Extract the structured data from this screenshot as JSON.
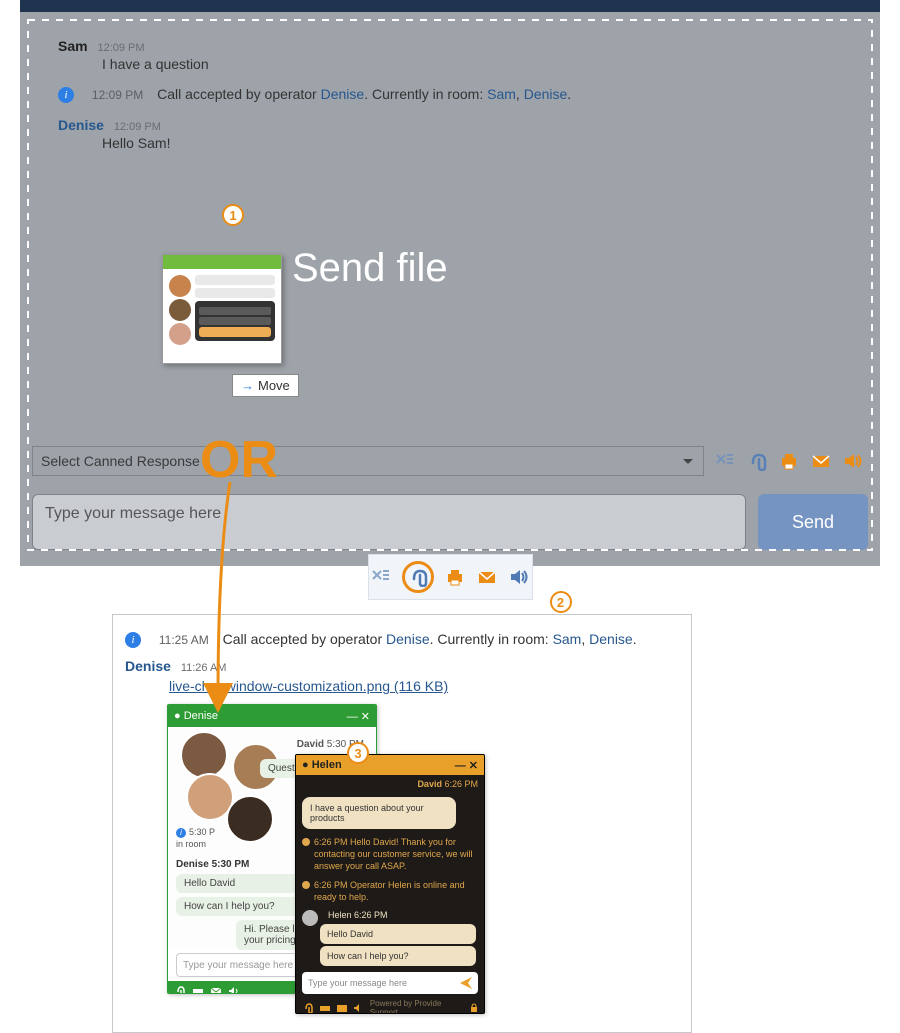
{
  "annotations": {
    "badge1": "1",
    "badge2": "2",
    "badge3": "3",
    "or_label": "OR"
  },
  "overlay": {
    "send_file": "Send file",
    "move_label": "Move"
  },
  "chat": {
    "msg1": {
      "sender": "Sam",
      "ts": "12:09 PM",
      "body": "I have a question"
    },
    "sys1": {
      "ts": "12:09 PM",
      "pre": "Call accepted by operator ",
      "op": "Denise",
      "mid": ". Currently in room: ",
      "p1": "Sam",
      "sep": ", ",
      "p2": "Denise",
      "end": "."
    },
    "msg2": {
      "sender": "Denise",
      "ts": "12:09 PM",
      "body": "Hello Sam!"
    }
  },
  "controls": {
    "canned_placeholder": "Select Canned Response",
    "input_placeholder": "Type your message here",
    "send_label": "Send"
  },
  "lower": {
    "sys": {
      "ts": "11:25 AM",
      "pre": "Call accepted by operator ",
      "op": "Denise",
      "mid": ". Currently in room: ",
      "p1": "Sam",
      "sep": ", ",
      "p2": "Denise",
      "end": "."
    },
    "denise": {
      "sender": "Denise",
      "ts": "11:26 AM"
    },
    "file": {
      "name": "live-chat-window-customization.png",
      "size": "(116 KB)"
    }
  },
  "mini_green": {
    "name": "Denise",
    "visitor": "David",
    "visitor_ts": "5:30 PM",
    "q": "Question about your",
    "sys_ts": "5:30 P",
    "sys_txt": "in room",
    "op_row": "Denise 5:30 PM",
    "m1": "Hello David",
    "m2": "How can I help you?",
    "m3": "Hi. Please let me",
    "m4": "your pricing",
    "input_ph": "Type your message here"
  },
  "mini_black": {
    "name": "Helen",
    "visitor": "David",
    "visitor_ts": "6:26 PM",
    "q": "I have a question about your products",
    "sys1": "6:26 PM Hello David! Thank you for contacting our customer service, we will answer your call ASAP.",
    "sys2": "6:26 PM Operator Helen is online and ready to help.",
    "op_row": "Helen 6:26 PM",
    "m1": "Hello David",
    "m2": "How can I help you?",
    "input_ph": "Type your message here",
    "credit": "Powered by Provide Support"
  }
}
